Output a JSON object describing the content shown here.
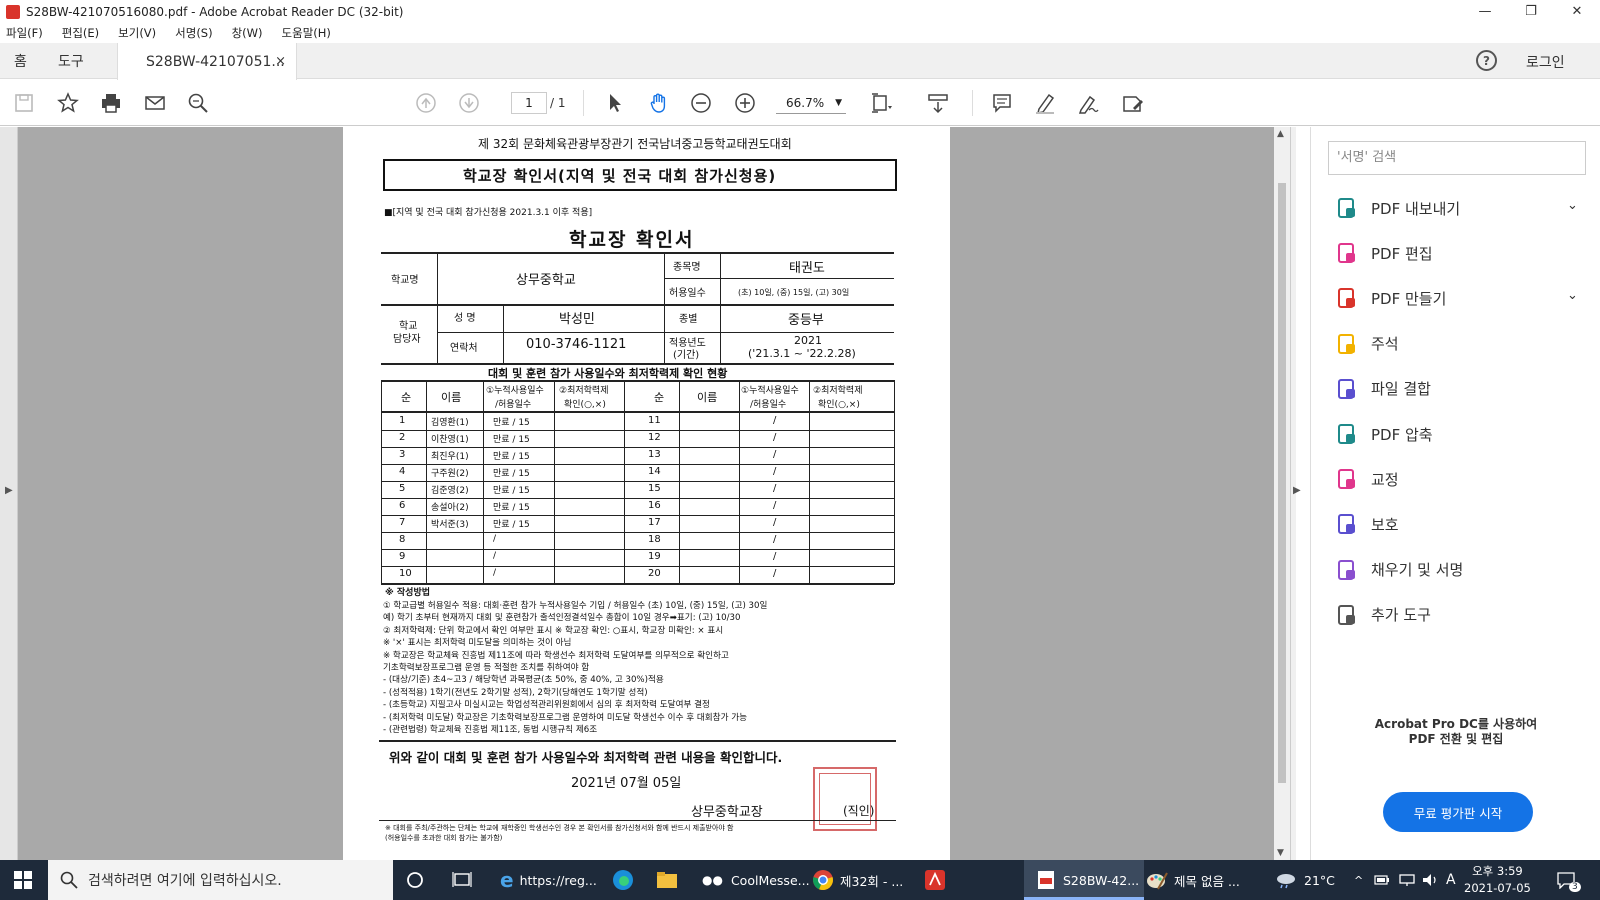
{
  "window": {
    "title": "S28BW-421070516080.pdf - Adobe Acrobat Reader DC (32-bit)",
    "minimize": "—",
    "restore": "❐",
    "close": "✕"
  },
  "menu": [
    "파일(F)",
    "편집(E)",
    "보기(V)",
    "서명(S)",
    "창(W)",
    "도움말(H)"
  ],
  "tabs": {
    "home": "홈",
    "tools": "도구",
    "doc": "S28BW-42107051...",
    "close": "×"
  },
  "topright": {
    "help": "?",
    "login": "로그인"
  },
  "toolbar": {
    "page_current": "1",
    "page_total": "/ 1",
    "zoom": "66.7%"
  },
  "panel": {
    "search_placeholder": "'서명' 검색",
    "tools": [
      {
        "label": "PDF 내보내기",
        "chevron": true,
        "color": "#1f8a8a"
      },
      {
        "label": "PDF 편집",
        "chevron": false,
        "color": "#e0368c"
      },
      {
        "label": "PDF 만들기",
        "chevron": true,
        "color": "#d9342b"
      },
      {
        "label": "주석",
        "chevron": false,
        "color": "#f2b200"
      },
      {
        "label": "파일 결합",
        "chevron": false,
        "color": "#5a4fcf"
      },
      {
        "label": "PDF 압축",
        "chevron": false,
        "color": "#1f8a8a"
      },
      {
        "label": "교정",
        "chevron": false,
        "color": "#e0368c"
      },
      {
        "label": "보호",
        "chevron": false,
        "color": "#5a4fcf"
      },
      {
        "label": "채우기 및 서명",
        "chevron": false,
        "color": "#8a4fcf"
      },
      {
        "label": "추가 도구",
        "chevron": false,
        "color": "#555555"
      }
    ],
    "promo_line1": "Acrobat Pro DC를 사용하여",
    "promo_line2": "PDF 전환 및 편집",
    "try_button": "무료 평가판 시작"
  },
  "document": {
    "header": "제 32회 문화체육관광부장관기 전국남녀중고등학교태권도대회",
    "title_box": "학교장 확인서(지역 및 전국 대회 참가신청용)",
    "note": "■[지역 및 전국 대회 참가신청용 2021.3.1 이후 적용]",
    "main_title": "학교장 확인서",
    "school_label": "학교명",
    "school_value": "상무중학교",
    "event_label": "종목명",
    "event_value": "태권도",
    "allow_label": "허용일수",
    "allow_value": "(초) 10일, (중) 15일, (고) 30일",
    "manager_label1": "학교",
    "manager_label2": "담당자",
    "name_label": "성 명",
    "name_value": "박성민",
    "division_label": "종별",
    "division_value": "중등부",
    "contact_label": "연락처",
    "contact_value": "010-3746-1121",
    "year_label1": "적용년도",
    "year_label2": "(기간)",
    "year_value1": "2021",
    "year_value2": "('21.3.1 ~ '22.2.28)",
    "status_title": "대회 및 훈련 참가 사용일수와 최저학력제 확인 현황",
    "col_no": "순",
    "col_name": "이름",
    "col_days1": "①누적사용일수",
    "col_days2": "/허용일수",
    "col_min1": "②최저학력제",
    "col_min2": "확인(○,×)",
    "rows_left": [
      {
        "no": "1",
        "name": "김영환(1)",
        "days": "만료 / 15"
      },
      {
        "no": "2",
        "name": "이찬영(1)",
        "days": "만료 / 15"
      },
      {
        "no": "3",
        "name": "최진우(1)",
        "days": "만료 / 15"
      },
      {
        "no": "4",
        "name": "구주원(2)",
        "days": "만료 / 15"
      },
      {
        "no": "5",
        "name": "김준영(2)",
        "days": "만료 / 15"
      },
      {
        "no": "6",
        "name": "송설아(2)",
        "days": "만료 / 15"
      },
      {
        "no": "7",
        "name": "박서준(3)",
        "days": "만료 / 15"
      },
      {
        "no": "8",
        "name": "",
        "days": "/"
      },
      {
        "no": "9",
        "name": "",
        "days": "/"
      },
      {
        "no": "10",
        "name": "",
        "days": "/"
      }
    ],
    "rows_right": [
      "11",
      "12",
      "13",
      "14",
      "15",
      "16",
      "17",
      "18",
      "19",
      "20"
    ],
    "slash": "/",
    "method_title": "※ 작성방법",
    "method_lines": [
      "① 학교급별 허용일수 적용: 대회·훈련 참가 누적사용일수 기입 / 허용일수 (초) 10일, (중) 15일, (고) 30일",
      "   예) 학기 초부터 현재까지 대회 및 훈련참가 출석인정결석일수 총합이 10일 경우➡표기: (고) 10/30",
      "② 최저학력제: 단위 학교에서 확인 여부만 표시 ※ 학교장 확인: ○표시, 학교장 미확인: × 표시",
      "   ※ '×' 표시는 최저학력 미도달을 의미하는 것이 아님",
      "   ※ 학교장은 학교체육 진흥법 제11조에 따라 학생선수 최저학력 도달여부를 의무적으로 확인하고",
      "      기초학력보장프로그램 운영 등 적절한 조치를 취하여야 함",
      "- (대상/기준) 초4~고3 / 해당학년 과목평균(초 50%, 중 40%, 고 30%)적용",
      "- (성적적용) 1학기(전년도 2학기말 성적), 2학기(당해연도 1학기말 성적)",
      "- (초등학교) 지필고사 미실시교는 학업성적관리위원회에서 심의 후 최저학력 도달여부 결정",
      "- (최저학력 미도달) 학교장은 기초학력보장프로그램 운영하여 미도달 학생선수 이수 후 대회참가 가능",
      "- (관련법령) 학교체육 진흥법 제11조, 동법 시행규칙 제6조"
    ],
    "confirm_text": "위와 같이 대회 및 훈련 참가 사용일수와 최저학력 관련 내용을 확인합니다.",
    "date": "2021년 07월 05일",
    "principal": "상무중학교장",
    "seal": "(직인)",
    "footnote1": "※ 대회를 주최/주관하는 단체는 학교에 재학중인 학생선수인 경우 본 확인서를 참가신청서와 함께 반드시 제출받아야 함",
    "footnote2": "(허용일수를 초과한 대회 참가는 불가함)"
  },
  "taskbar": {
    "search_placeholder": "검색하려면 여기에 입력하십시오.",
    "apps": [
      {
        "label": "https://reg..."
      },
      {
        "label": "CoolMesse..."
      },
      {
        "label": "제32회 - ..."
      },
      {
        "label": "S28BW-42..."
      },
      {
        "label": "제목 없음 ..."
      }
    ],
    "weather": "21°C",
    "ime": "A",
    "time": "오후 3:59",
    "date": "2021-07-05",
    "notif": "3"
  }
}
